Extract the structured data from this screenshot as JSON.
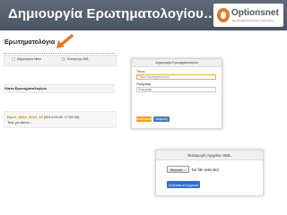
{
  "header": {
    "title": "Δημιουργία Ερωτηματολογίου…",
    "logo_text": "Optionsnet",
    "logo_subtext": "Professional Business Solutions"
  },
  "left_panel": {
    "page_title": "Ερωτηματολόγια",
    "toolbar": {
      "create_new_label": "Δημιουργία Νέου",
      "import_xml_label": "Εισαγωγή XML"
    },
    "list_title": "Λίστα Ερωτηματολογίων",
    "items": [
      {
        "name": "Eρωτ_Αβέλ_2014_15",
        "date": "(2014-09-30 17:59:43)",
        "description": "Test για demo..."
      }
    ]
  },
  "create_dialog": {
    "title": "Δημιουργία Ερωτηματολογίου",
    "title_label": "Τίτλος",
    "title_placeholder": "Τίτλος Ερωτηματολογίου",
    "description_label": "Περιγραφή",
    "description_placeholder": "Περιγραφή",
    "save_label": "Αποθήκευση",
    "cancel_label": "Ακύρωση"
  },
  "import_dialog": {
    "title": "Εισαγωγή Αρχείου XML",
    "browse_label": "Browse...",
    "file_status": "No file selected.",
    "upload_label": "Ανέβασμα Αρχείου"
  },
  "colors": {
    "header_bg": "#5a6573",
    "save_button": "#f0a020",
    "cancel_button": "#4a78b8",
    "upload_button": "#2f6fc4",
    "arrow": "#e07b2a"
  }
}
